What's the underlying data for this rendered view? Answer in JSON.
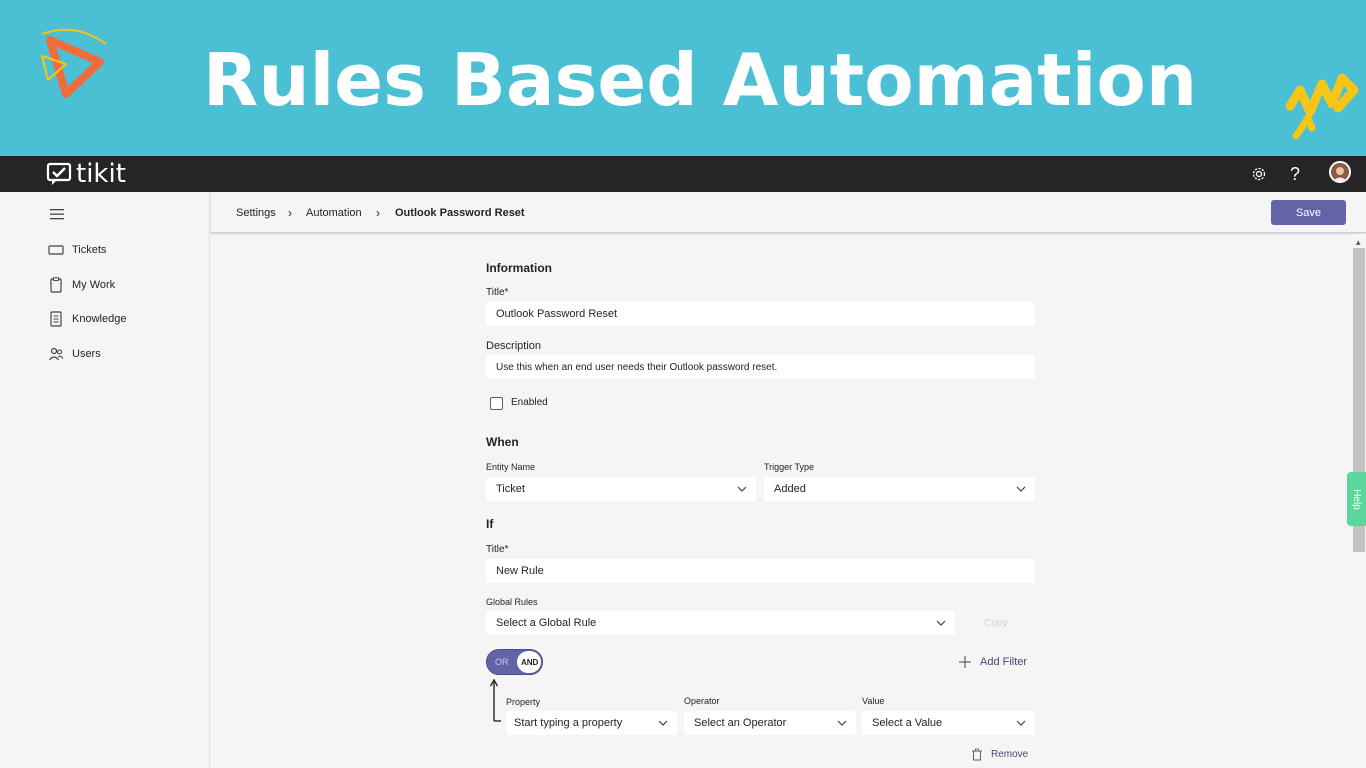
{
  "banner": {
    "title": "Rules Based Automation",
    "colors": {
      "background": "#4bc0d4",
      "logo_orange": "#f26b3a",
      "logo_yellow": "#f5c518",
      "zigzag": "#f5c518"
    }
  },
  "topbar": {
    "brand": "tikit",
    "icons": [
      "gear-icon",
      "help-icon",
      "avatar"
    ]
  },
  "sidebar": {
    "menu_icon": "hamburger-icon",
    "items": [
      {
        "label": "Tickets",
        "icon": "ticket-icon"
      },
      {
        "label": "My Work",
        "icon": "clipboard-icon"
      },
      {
        "label": "Knowledge",
        "icon": "document-icon"
      },
      {
        "label": "Users",
        "icon": "users-icon"
      }
    ]
  },
  "header": {
    "breadcrumb": [
      "Settings",
      "Automation",
      "Outlook Password Reset"
    ],
    "save_label": "Save",
    "accent": "#6264a7"
  },
  "help_tab": "Help",
  "form": {
    "information": {
      "heading": "Information",
      "title_label": "Title*",
      "title_value": "Outlook Password Reset",
      "description_label": "Description",
      "description_value": "Use this when an end user needs their Outlook password reset.",
      "enabled_label": "Enabled",
      "enabled": false
    },
    "when": {
      "heading": "When",
      "entity_label": "Entity Name",
      "entity_value": "Ticket",
      "trigger_label": "Trigger Type",
      "trigger_value": "Added"
    },
    "if": {
      "heading": "If",
      "title_label": "Title*",
      "title_value": "New Rule",
      "global_rules_label": "Global Rules",
      "global_rules_value": "Select a Global Rule",
      "copy_label": "Copy",
      "toggle_or": "OR",
      "toggle_and": "AND",
      "add_filter_label": "Add Filter",
      "property_label": "Property",
      "property_placeholder": "Start typing a property",
      "operator_label": "Operator",
      "operator_placeholder": "Select an Operator",
      "value_label": "Value",
      "value_placeholder": "Select a Value",
      "remove_label": "Remove"
    }
  }
}
